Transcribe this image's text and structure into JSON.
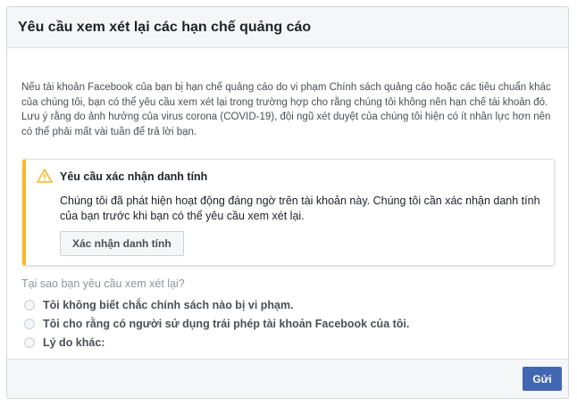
{
  "dialog": {
    "title": "Yêu cầu xem xét lại các hạn chế quảng cáo",
    "intro": "Nếu tài khoản Facebook của bạn bị hạn chế quảng cáo do vi phạm Chính sách quảng cáo hoặc các tiêu chuẩn khác của chúng tôi, bạn có thể yêu cầu xem xét lại trong trường hợp cho rằng chúng tôi không nên hạn chế tài khoản đó. Lưu ý rằng do ảnh hưởng của virus corona (COVID-19), đội ngũ xét duyệt của chúng tôi hiện có ít nhân lực hơn nên có thể phải mất vài tuần để trả lời bạn."
  },
  "warning": {
    "icon": "warning-triangle-icon",
    "accent_color": "#f7b928",
    "title": "Yêu cầu xác nhận danh tính",
    "text": "Chúng tôi đã phát hiện hoạt động đáng ngờ trên tài khoản này. Chúng tôi cần xác nhận danh tính của bạn trước khi bạn có thể yêu cầu xem xét lại.",
    "button_label": "Xác nhận danh tính"
  },
  "reason": {
    "question": "Tại sao bạn yêu cầu xem xét lại?",
    "options": [
      "Tôi không biết chắc chính sách nào bị vi phạm.",
      "Tôi cho rằng có người sử dụng trái phép tài khoản Facebook của tôi.",
      "Lý do khác:"
    ]
  },
  "footer": {
    "submit_label": "Gửi",
    "submit_color": "#4267b2"
  }
}
